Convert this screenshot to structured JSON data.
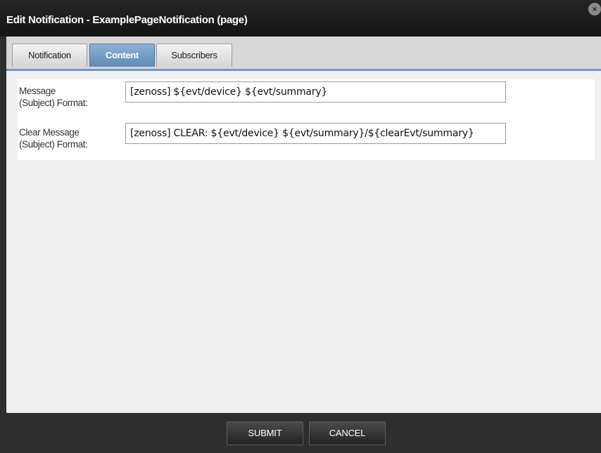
{
  "dialog": {
    "title": "Edit Notification - ExamplePageNotification (page)",
    "close_icon": "×"
  },
  "tabs": [
    {
      "label": "Notification",
      "active": false
    },
    {
      "label": "Content",
      "active": true
    },
    {
      "label": "Subscribers",
      "active": false
    }
  ],
  "form": {
    "message": {
      "label_line1": "Message",
      "label_line2": "(Subject) Format:",
      "value": "[zenoss] ${evt/device} ${evt/summary}"
    },
    "clear_message": {
      "label_line1": "Clear Message",
      "label_line2": "(Subject) Format:",
      "value": "[zenoss] CLEAR: ${evt/device} ${evt/summary}/${clearEvt/summary}"
    }
  },
  "footer": {
    "submit_label": "SUBMIT",
    "cancel_label": "CANCEL"
  },
  "colors": {
    "titlebar": "#1c1c1c",
    "active_tab": "#6f98bd",
    "footer": "#2e2e2e"
  }
}
